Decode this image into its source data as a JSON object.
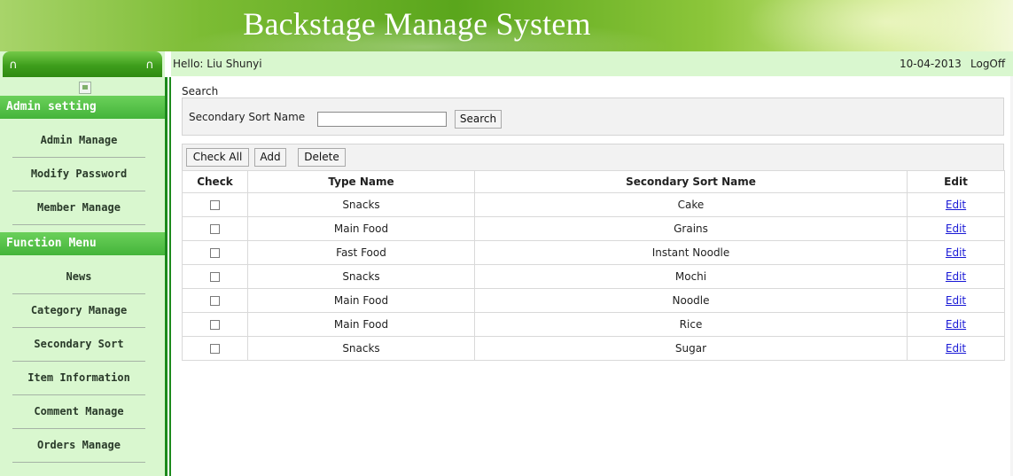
{
  "banner": {
    "title": "Backstage Manage System"
  },
  "header": {
    "greeting": "Hello: Liu Shunyi",
    "date": "10-04-2013",
    "logoff_label": "LogOff"
  },
  "sidebar": {
    "admin_section": "Admin setting",
    "admin_items": [
      "Admin Manage",
      "Modify Password",
      "Member Manage"
    ],
    "function_section": "Function Menu",
    "function_items": [
      "News",
      "Category Manage",
      "Secondary Sort",
      "Item Information",
      "Comment Manage",
      "Orders Manage"
    ]
  },
  "search": {
    "section_label": "Search",
    "field_label": "Secondary Sort Name",
    "input_value": "",
    "button_label": "Search"
  },
  "toolbar": {
    "check_all_label": "Check All",
    "add_label": "Add",
    "delete_label": "Delete"
  },
  "table": {
    "columns": [
      "Check",
      "Type Name",
      "Secondary Sort Name",
      "Edit"
    ],
    "rows": [
      {
        "type_name": "Snacks",
        "secondary_sort_name": "Cake",
        "edit": "Edit"
      },
      {
        "type_name": "Main Food",
        "secondary_sort_name": "Grains",
        "edit": "Edit"
      },
      {
        "type_name": "Fast Food",
        "secondary_sort_name": "Instant Noodle",
        "edit": "Edit"
      },
      {
        "type_name": "Snacks",
        "secondary_sort_name": "Mochi",
        "edit": "Edit"
      },
      {
        "type_name": "Main Food",
        "secondary_sort_name": "Noodle",
        "edit": "Edit"
      },
      {
        "type_name": "Main Food",
        "secondary_sort_name": "Rice",
        "edit": "Edit"
      },
      {
        "type_name": "Snacks",
        "secondary_sort_name": "Sugar",
        "edit": "Edit"
      }
    ]
  },
  "colors": {
    "sidebar_bg": "#d9f7cf",
    "section_header": "#44b43a",
    "divider_green": "#1c8a1c",
    "link": "#1a1ad6"
  }
}
